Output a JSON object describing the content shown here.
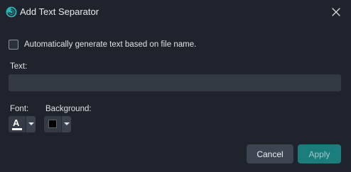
{
  "window": {
    "title": "Add Text Separator",
    "icon": "app-swirl-icon",
    "close_icon": "close-icon"
  },
  "options": {
    "auto_generate_label": "Automatically generate text based on file name.",
    "auto_generate_checked": false
  },
  "text_field": {
    "label": "Text:",
    "value": "",
    "placeholder": ""
  },
  "font": {
    "label": "Font:",
    "glyph": "A",
    "color": "#ffffff"
  },
  "background": {
    "label": "Background:",
    "color": "#000000"
  },
  "buttons": {
    "cancel": "Cancel",
    "apply": "Apply"
  },
  "colors": {
    "dialog_bg": "#1f232b",
    "accent": "#1b7c7c",
    "brand_icon": "#27b3b3"
  }
}
